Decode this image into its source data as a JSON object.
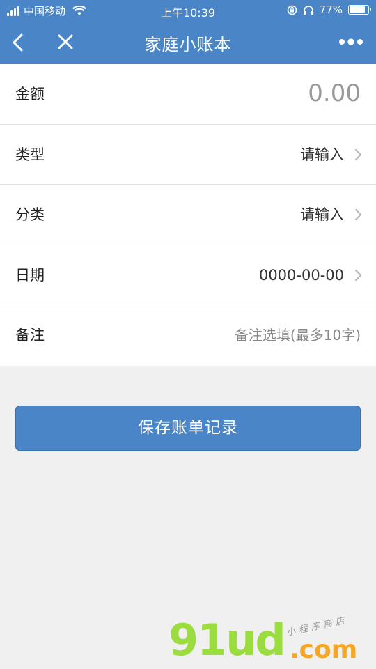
{
  "status_bar": {
    "carrier": "中国移动",
    "time": "上午10:39",
    "battery": "77%"
  },
  "nav": {
    "title": "家庭小账本"
  },
  "form": {
    "amount": {
      "label": "金额",
      "value": "0.00"
    },
    "type": {
      "label": "类型",
      "value": "请输入"
    },
    "category": {
      "label": "分类",
      "value": "请输入"
    },
    "date": {
      "label": "日期",
      "value": "0000-00-00"
    },
    "note": {
      "label": "备注",
      "placeholder": "备注选填(最多10字)"
    }
  },
  "actions": {
    "save_label": "保存账单记录"
  },
  "watermark": {
    "main": "91ud",
    "domain": ".com",
    "sub": "小程序商店"
  },
  "colors": {
    "header": "#4a86c7",
    "button": "#4a86c7",
    "background": "#f0f0f0"
  }
}
